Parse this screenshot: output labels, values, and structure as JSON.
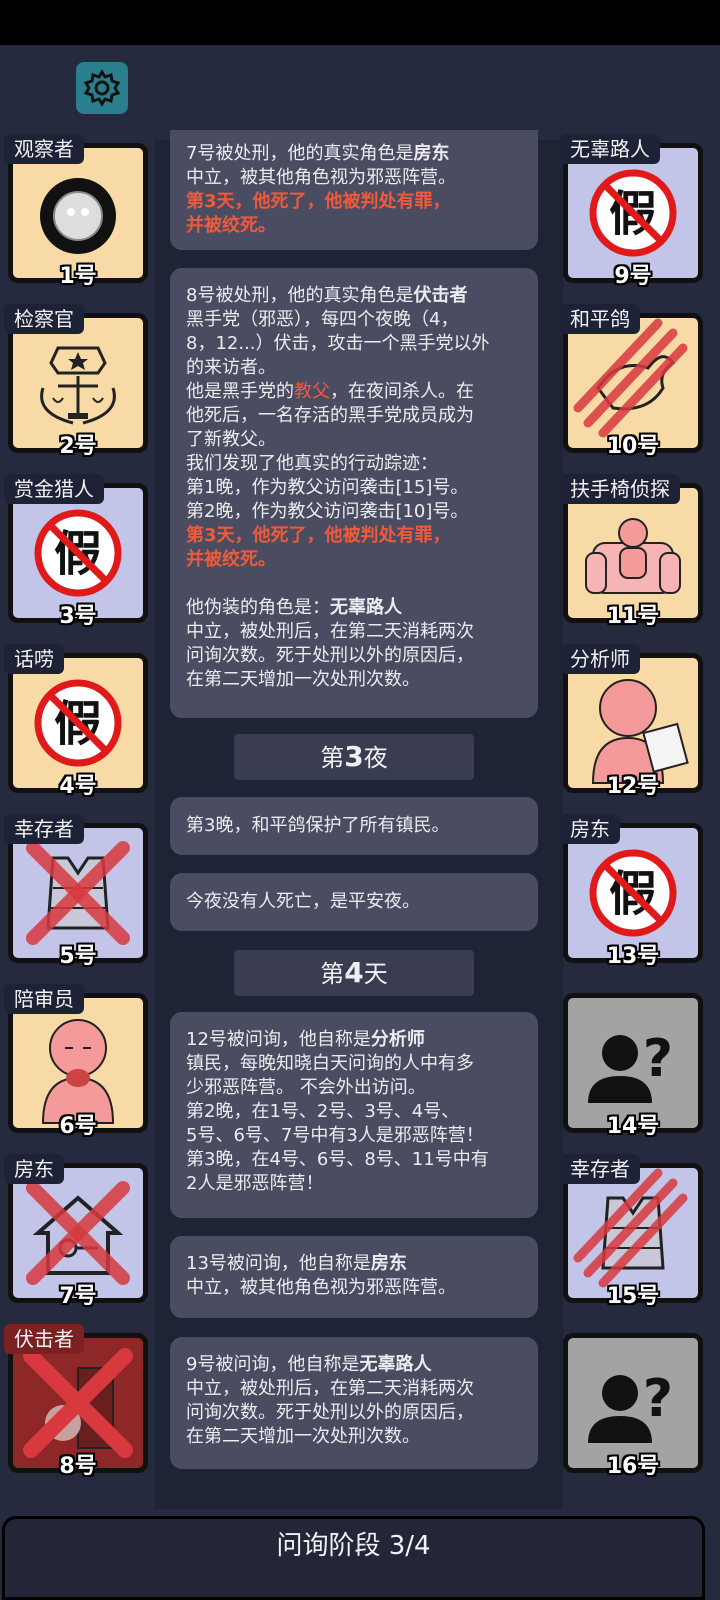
{
  "phase_label": "问询阶段 3/4",
  "left_players": [
    {
      "role": "观察者",
      "num": "1号",
      "art": "eye",
      "status": "alive"
    },
    {
      "role": "检察官",
      "num": "2号",
      "art": "badge",
      "status": "alive"
    },
    {
      "role": "赏金猎人",
      "num": "3号",
      "art": "fake",
      "status": "alive"
    },
    {
      "role": "话唠",
      "num": "4号",
      "art": "fake",
      "status": "alive"
    },
    {
      "role": "幸存者",
      "num": "5号",
      "art": "vest",
      "status": "dead-x"
    },
    {
      "role": "陪审员",
      "num": "6号",
      "art": "person",
      "status": "alive"
    },
    {
      "role": "房东",
      "num": "7号",
      "art": "house",
      "status": "dead-x"
    },
    {
      "role": "伏击者",
      "num": "8号",
      "art": "person",
      "status": "dead-red"
    }
  ],
  "right_players": [
    {
      "role": "无辜路人",
      "num": "9号",
      "art": "fake",
      "status": "alive"
    },
    {
      "role": "和平鸽",
      "num": "10号",
      "art": "dove",
      "status": "dead-claw"
    },
    {
      "role": "扶手椅侦探",
      "num": "11号",
      "art": "chair",
      "status": "alive"
    },
    {
      "role": "分析师",
      "num": "12号",
      "art": "person",
      "status": "alive"
    },
    {
      "role": "房东",
      "num": "13号",
      "art": "fake",
      "status": "alive"
    },
    {
      "role": "",
      "num": "14号",
      "art": "unknown",
      "status": "unknown"
    },
    {
      "role": "幸存者",
      "num": "15号",
      "art": "vest",
      "status": "dead-claw"
    },
    {
      "role": "",
      "num": "16号",
      "art": "unknown",
      "status": "unknown"
    }
  ],
  "fake_char": "假",
  "unknown_char": "?",
  "messages": {
    "m1": {
      "l1a": "7号被处刑，他的真实角色是",
      "l1b": "房东",
      "l2": "中立，被其他角色视为邪恶阵营。",
      "l3": "第3天，他死了，他被判处有罪，",
      "l4": "并被绞死。"
    },
    "m2": {
      "l1a": "8号被处刑，他的真实角色是",
      "l1b": "伏击者",
      "l2": "黑手党（邪恶），每四个夜晚（4，",
      "l3": "8，12...）伏击，攻击一个黑手党以外",
      "l4": "的来访者。",
      "l5a": "他是黑手党的",
      "l5b": "教父",
      "l5c": "，在夜间杀人。在",
      "l6": "他死后，一名存活的黑手党成员成为",
      "l7": "了新教父。",
      "l8": "我们发现了他真实的行动踪迹：",
      "l9": "第1晚，作为教父访问袭击[15]号。",
      "l10": "第2晚，作为教父访问袭击[10]号。",
      "l11": "第3天，他死了，他被判处有罪，",
      "l12": "并被绞死。",
      "l13a": "他伪装的角色是：",
      "l13b": "无辜路人",
      "l14": "中立，被处刑后，在第二天消耗两次",
      "l15": "问询次数。死于处刑以外的原因后，",
      "l16": "在第二天增加一次处刑次数。"
    },
    "night3": {
      "a": "第",
      "n": "3",
      "b": "夜"
    },
    "m3": "第3晚，和平鸽保护了所有镇民。",
    "m4": "今夜没有人死亡，是平安夜。",
    "day4": {
      "a": "第",
      "n": "4",
      "b": "天"
    },
    "m5": {
      "l1a": "12号被问询，他自称是",
      "l1b": "分析师",
      "l2": "镇民，每晚知晓白天问询的人中有多",
      "l3": "少邪恶阵营。 不会外出访问。",
      "l4": "第2晚，在1号、2号、3号、4号、",
      "l5": "5号、6号、7号中有3人是邪恶阵营！",
      "l6": "第3晚，在4号、6号、8号、11号中有",
      "l7": "2人是邪恶阵营！"
    },
    "m6": {
      "l1a": "13号被问询，他自称是",
      "l1b": "房东",
      "l2": "中立，被其他角色视为邪恶阵营。"
    },
    "m7": {
      "l1a": "9号被问询，他自称是",
      "l1b": "无辜路人",
      "l2": "中立，被处刑后，在第二天消耗两次",
      "l3": "问询次数。死于处刑以外的原因后，",
      "l4": "在第二天增加一次处刑次数。"
    }
  },
  "colors": {
    "background": "#262a3f",
    "accent_red": "#ef5a3a",
    "card_yellow": "#f8daa6",
    "card_lavender": "#c3c5e8",
    "gear": "#2a7f8e"
  }
}
